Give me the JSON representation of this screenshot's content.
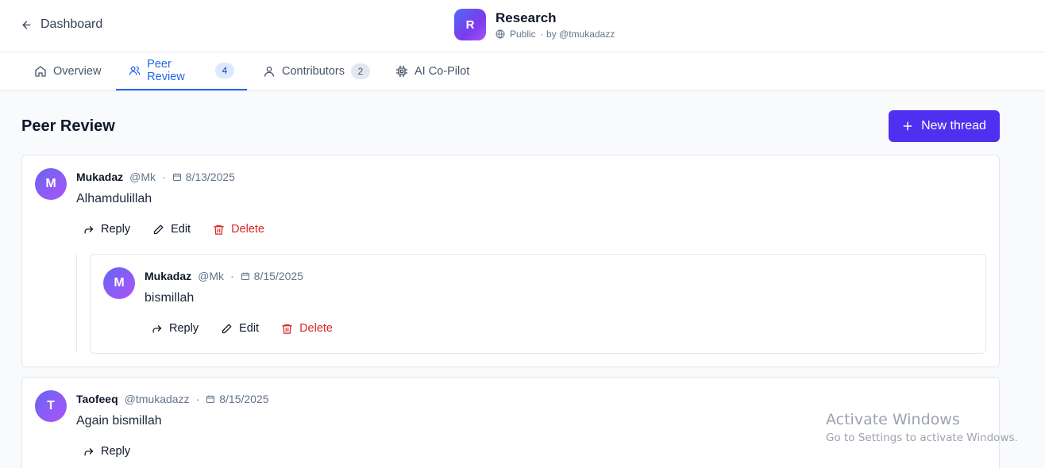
{
  "header": {
    "back_label": "Dashboard",
    "project": {
      "initial": "R",
      "title": "Research",
      "visibility": "Public",
      "owner": "· by @tmukadazz"
    }
  },
  "tabs": [
    {
      "label": "Overview",
      "icon": "home-icon",
      "count": null,
      "active": false
    },
    {
      "label": "Peer Review",
      "icon": "users-icon",
      "count": "4",
      "active": true
    },
    {
      "label": "Contributors",
      "icon": "user-icon",
      "count": "2",
      "active": false
    },
    {
      "label": "AI Co-Pilot",
      "icon": "chip-icon",
      "count": null,
      "active": false
    }
  ],
  "section": {
    "title": "Peer Review",
    "new_thread_label": "New thread"
  },
  "actions": {
    "reply": "Reply",
    "edit": "Edit",
    "delete": "Delete"
  },
  "threads": [
    {
      "initial": "M",
      "author": "Mukadaz",
      "handle": "@Mk",
      "separator": "·",
      "date": "8/13/2025",
      "text": "Alhamdulillah",
      "replies": [
        {
          "initial": "M",
          "author": "Mukadaz",
          "handle": "@Mk",
          "separator": "·",
          "date": "8/15/2025",
          "text": "bismillah"
        }
      ]
    },
    {
      "initial": "T",
      "author": "Taofeeq",
      "handle": "@tmukadazz",
      "separator": "·",
      "date": "8/15/2025",
      "text": "Again bismillah",
      "replies": []
    }
  ],
  "watermark": {
    "line1": "Activate Windows",
    "line2": "Go to Settings to activate Windows."
  },
  "colors": {
    "accent": "#2563eb",
    "primary_button": "#4f2ff0",
    "danger": "#dc2626"
  }
}
